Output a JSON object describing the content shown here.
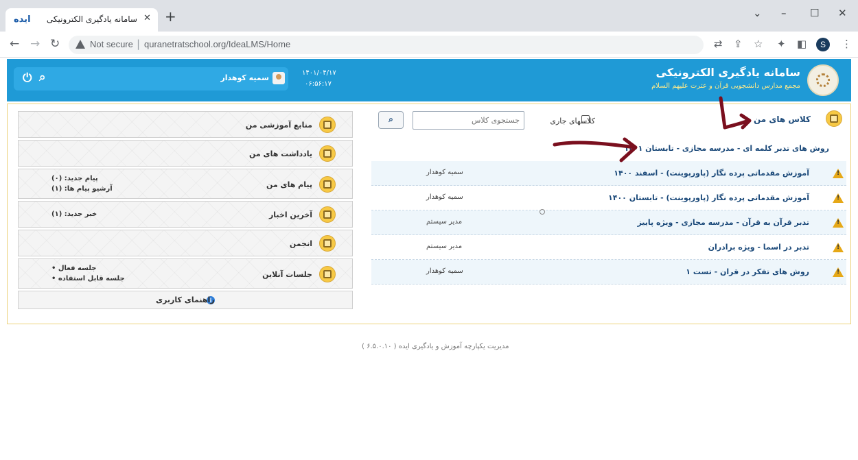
{
  "browser": {
    "tab_title": "سامانه یادگیری الکترونیکی",
    "tab_favicon": "ایده",
    "security_label": "Not secure",
    "url": "quranetratschool.org/IdeaLMS/Home",
    "profile_initial": "S"
  },
  "header": {
    "title": "سامانه یادگیری الکترونیکی",
    "subtitle": "مجمع مدارس دانشجویی قرآن و عترت علیهم السلام",
    "date": "۱۴۰۱/۰۴/۱۷",
    "time": "۰۶:۵۶:۱۷",
    "user_name": "سمیه کوهدار"
  },
  "classes": {
    "title": "کلاس های من",
    "current_filter_label": "کلاسهای جاری",
    "search_placeholder": "جستجوی کلاس",
    "first_item": "روش های تدبر کلمه ای - مدرسه مجازی - تابستان ۱۴۰۱",
    "rows": [
      {
        "name": "آموزش مقدماتی پرده نگار (پاورپوینت) - اسفند ۱۴۰۰",
        "teacher": "سمیه کوهدار"
      },
      {
        "name": "آموزش مقدماتی پرده نگار (پاورپوینت) - تابستان ۱۴۰۰",
        "teacher": "سمیه کوهدار"
      },
      {
        "name": "تدبر قرآن به قرآن - مدرسه مجازی - ویژه پاییز",
        "teacher": "مدیر سیستم"
      },
      {
        "name": "تدبر در اسما - ویژه برادران",
        "teacher": "مدیر سیستم"
      },
      {
        "name": "روش های تفکر در قران - تست ۱",
        "teacher": "سمیه کوهدار"
      }
    ]
  },
  "sidebar": {
    "resources": "منابع آموزشی من",
    "notes": "یادداشت های من",
    "messages": "پیام های من",
    "messages_new": "پیام جدید: (۰)",
    "messages_archive": "آرشیو پیام ها: (۱)",
    "news": "آخرین اخبار",
    "news_new": "خبر جدید: (۱)",
    "forum": "انجمن",
    "sessions": "جلسات آنلاین",
    "sessions_active": "جلسه فعال •",
    "sessions_usable": "جلسه قابل استفاده •",
    "guide": "راهنمای کاربری"
  },
  "footer": "مدیریت یکپارچه آموزش و یادگیری ایده ( ۶.۵.۰.۱۰ )",
  "colors": {
    "header_blue": "#1f9ad6",
    "accent_yellow": "#f7c945",
    "warning": "#e6a817",
    "annotation_arrow": "#7a0f1e"
  },
  "icons": {
    "power": "power-icon",
    "search": "search-icon",
    "warning": "warning-icon",
    "info": "info-icon"
  }
}
